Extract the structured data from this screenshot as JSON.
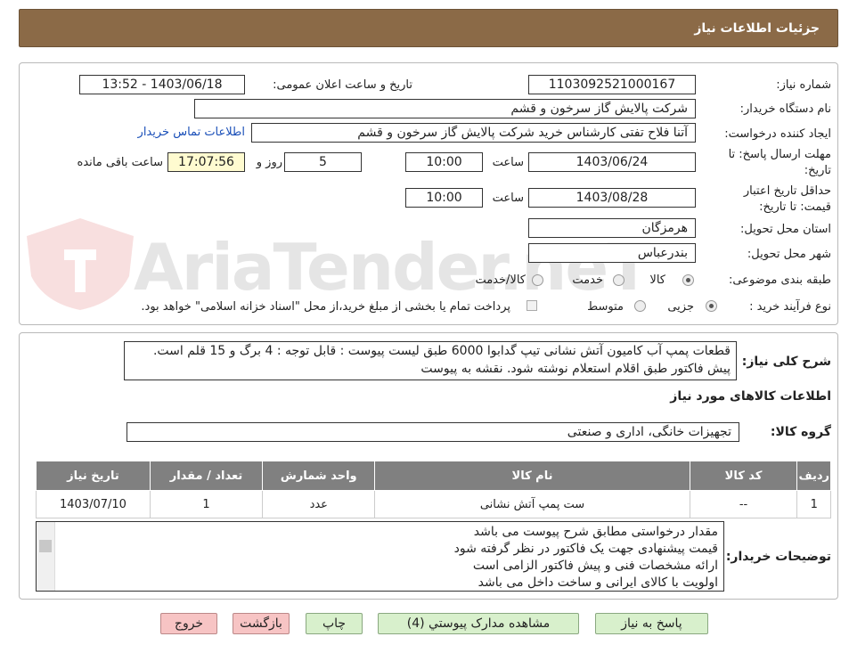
{
  "header": {
    "title": "جزئیات اطلاعات نیاز"
  },
  "fields": {
    "need_number_label": "شماره نیاز:",
    "need_number": "1103092521000167",
    "announce_label": "تاریخ و ساعت اعلان عمومی:",
    "announce_value": "1403/06/18 - 13:52",
    "buyer_org_label": "نام دستگاه خریدار:",
    "buyer_org": "شرکت پالایش گاز سرخون و قشم",
    "requester_label": "ایجاد کننده درخواست:",
    "requester": "آتنا فلاح تفتی کارشناس خرید شرکت پالایش گاز سرخون و قشم",
    "contact_link": "اطلاعات تماس خریدار",
    "deadline_label_1": "مهلت ارسال پاسخ: تا",
    "deadline_label_2": "تاریخ:",
    "deadline_date": "1403/06/24",
    "time_label": "ساعت",
    "deadline_time": "10:00",
    "days_value": "5",
    "days_label": "روز و",
    "remaining_time": "17:07:56",
    "remaining_label": "ساعت باقی مانده",
    "validity_label_1": "حداقل تاریخ اعتبار",
    "validity_label_2": "قیمت: تا تاریخ:",
    "validity_date": "1403/08/28",
    "validity_time": "10:00",
    "province_label": "استان محل تحویل:",
    "province": "هرمزگان",
    "city_label": "شهر محل تحویل:",
    "city": "بندرعباس",
    "category_label": "طبقه بندی موضوعی:",
    "category_options": [
      "کالا",
      "خدمت",
      "کالا/خدمت"
    ],
    "process_label": "نوع فرآیند خرید :",
    "process_options": [
      "جزیی",
      "متوسط"
    ],
    "payment_note": "پرداخت تمام یا بخشی از مبلغ خرید،از محل \"اسناد خزانه اسلامی\" خواهد بود."
  },
  "summary": {
    "label": "شرح کلی نیاز:",
    "line1": "قطعات پمپ آب کامیون آتش نشانی تیپ گدابوا 6000 طبق لیست پیوست : قابل توجه : 4 برگ و 15 قلم است.",
    "line2": "پیش فاکتور طبق اقلام استعلام نوشته شود. نقشه به پیوست"
  },
  "goods": {
    "section_title": "اطلاعات کالاهای مورد نیاز",
    "group_label": "گروه کالا:",
    "group_value": "تجهیزات خانگی، اداری و صنعتی",
    "columns": [
      "ردیف",
      "کد کالا",
      "نام کالا",
      "واحد شمارش",
      "تعداد / مقدار",
      "تاریخ نیاز"
    ],
    "rows": [
      [
        "1",
        "--",
        "ست پمپ آتش نشانی",
        "عدد",
        "1",
        "1403/07/10"
      ]
    ]
  },
  "buyer_notes": {
    "label": "توضیحات خریدار:",
    "lines": [
      "مقدار درخواستی مطابق شرح پیوست می باشد",
      "قیمت پیشنهادی جهت یک فاکتور در نظر گرفته شود",
      "ارائه مشخصات فنی و پیش فاکتور الزامی است",
      "اولویت با کالای ایرانی و ساخت داخل می باشد"
    ]
  },
  "buttons": {
    "reply": "پاسخ به نیاز",
    "attachments": "مشاهده مدارک پیوستي (4)",
    "print": "چاپ",
    "back": "بازگشت",
    "exit": "خروج"
  },
  "watermark": {
    "text": "AriaTender.neT"
  },
  "colors": {
    "header_bg": "#8b6a47",
    "table_header": "#808080",
    "green_button": "#d8f0cc",
    "red_button": "#f7c4c4",
    "link": "#1a4fb8"
  }
}
